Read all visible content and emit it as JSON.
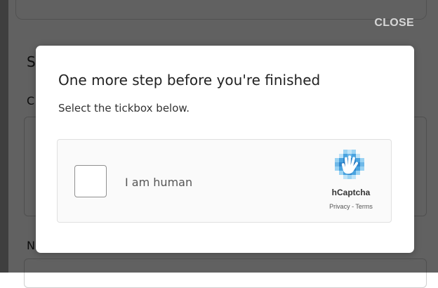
{
  "background": {
    "letters": [
      "S",
      "C",
      "N"
    ]
  },
  "overlay": {
    "close_label": "CLOSE"
  },
  "modal": {
    "title": "One more step before you're finished",
    "subtitle": "Select the tickbox below."
  },
  "captcha": {
    "checkbox_label": "I am human",
    "brand": "hCaptcha",
    "privacy_label": "Privacy",
    "separator": " - ",
    "terms_label": "Terms",
    "logo_icon": "hcaptcha-hand-icon",
    "colors": {
      "logo_blue": "#4aa3df",
      "logo_light": "#9bd3f3",
      "logo_dark": "#1f6fb8"
    }
  }
}
